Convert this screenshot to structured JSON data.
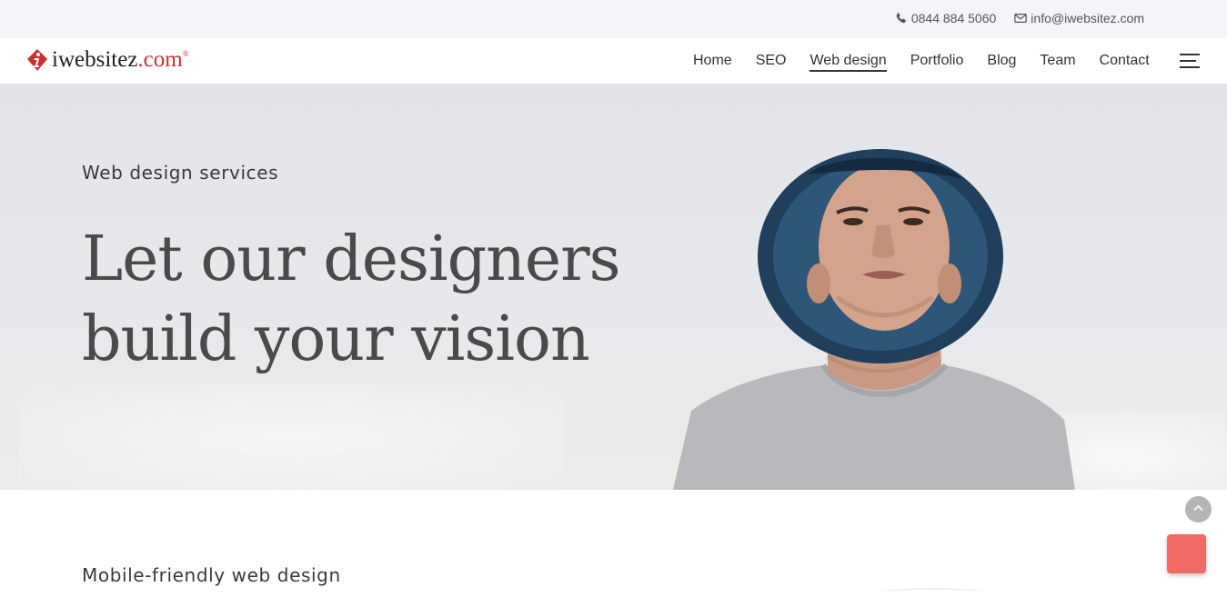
{
  "topbar": {
    "phone": "0844 884 5060",
    "email": "info@iwebsitez.com"
  },
  "logo": {
    "name": "iwebsitez",
    "tld": ".com",
    "registered": "®"
  },
  "nav": {
    "items": [
      {
        "label": "Home"
      },
      {
        "label": "SEO"
      },
      {
        "label": "Web design"
      },
      {
        "label": "Portfolio"
      },
      {
        "label": "Blog"
      },
      {
        "label": "Team"
      },
      {
        "label": "Contact"
      }
    ],
    "active": "Web design"
  },
  "hero": {
    "kicker": "Web design services",
    "headline_line1": "Let our designers",
    "headline_line2": "build your vision"
  },
  "section2": {
    "subtitle": "Mobile-friendly web design"
  },
  "colors": {
    "brand_red": "#d02f32",
    "chat_button": "#ee6a63",
    "topbar_bg": "#f4f5f9"
  },
  "icons": {
    "phone": "phone-icon",
    "email": "envelope-icon",
    "menu": "hamburger-icon",
    "scroll_top": "chevron-up-icon"
  }
}
